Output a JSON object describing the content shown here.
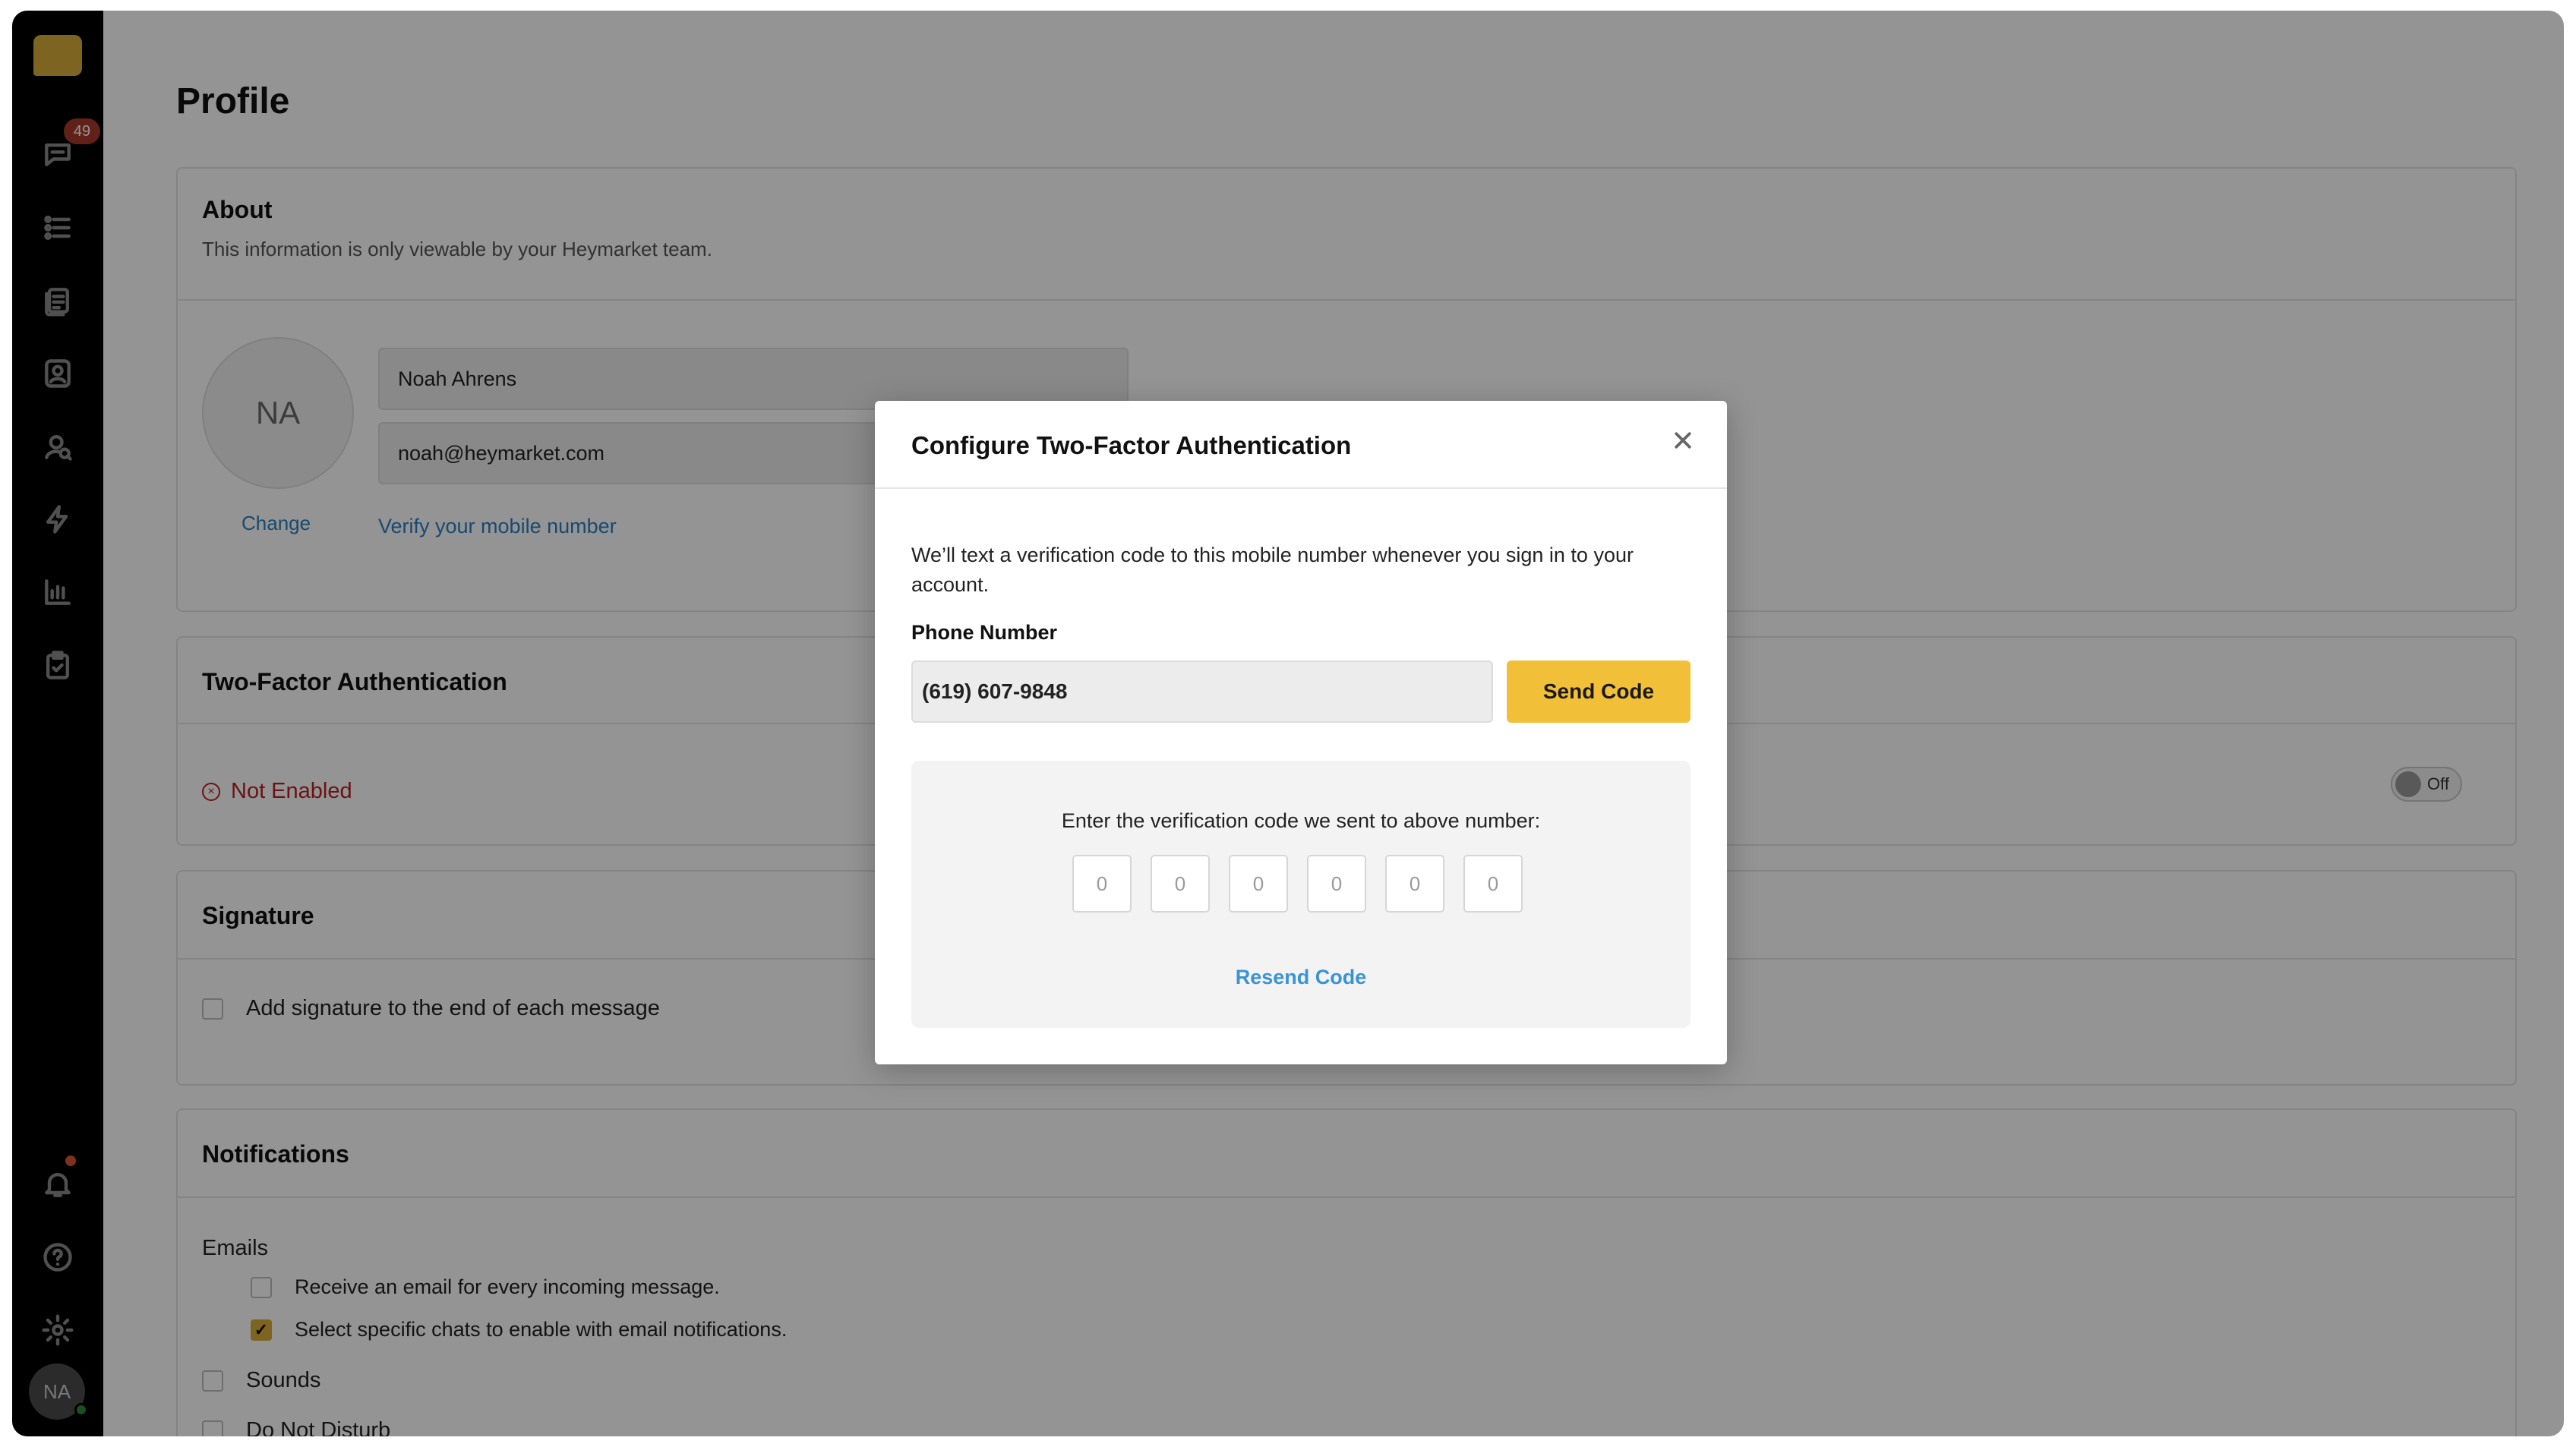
{
  "sidebar": {
    "notification_badge": "49",
    "items": [
      {
        "icon": "chat-icon"
      },
      {
        "icon": "list-icon"
      },
      {
        "icon": "documents-icon"
      },
      {
        "icon": "contacts-icon"
      },
      {
        "icon": "search-contacts-icon"
      },
      {
        "icon": "lightning-icon"
      },
      {
        "icon": "analytics-icon"
      },
      {
        "icon": "clipboard-check-icon"
      }
    ],
    "bottom_items": [
      {
        "icon": "bell-icon"
      },
      {
        "icon": "help-icon"
      },
      {
        "icon": "gear-icon"
      }
    ],
    "avatar_initials": "NA"
  },
  "page": {
    "title": "Profile"
  },
  "about": {
    "title": "About",
    "subtitle": "This information is only viewable by your Heymarket team.",
    "avatar_initials": "NA",
    "change_link": "Change",
    "name_value": "Noah Ahrens",
    "email_value": "noah@heymarket.com",
    "verify_link": "Verify your mobile number"
  },
  "two_factor": {
    "title": "Two-Factor Authentication",
    "status": "Not Enabled",
    "toggle_label": "Off"
  },
  "signature": {
    "title": "Signature",
    "checkbox_label": "Add signature to the end of each message"
  },
  "notifications": {
    "title": "Notifications",
    "emails_label": "Emails",
    "email_option_1": "Receive an email for every incoming message.",
    "email_option_2": "Select specific chats to enable with email notifications.",
    "sounds_label": "Sounds",
    "dnd_label": "Do Not Disturb"
  },
  "modal": {
    "title": "Configure Two-Factor Authentication",
    "description": "We’ll text a verification code to this mobile number whenever you sign in to your account.",
    "phone_label": "Phone Number",
    "phone_value": "(619) 607-9848",
    "send_button": "Send Code",
    "code_prompt": "Enter the verification code we sent to above number:",
    "code_placeholders": [
      "0",
      "0",
      "0",
      "0",
      "0",
      "0"
    ],
    "resend_link": "Resend Code"
  },
  "colors": {
    "accent": "#f2c038",
    "link": "#2b7fc2",
    "error": "#b82222"
  }
}
